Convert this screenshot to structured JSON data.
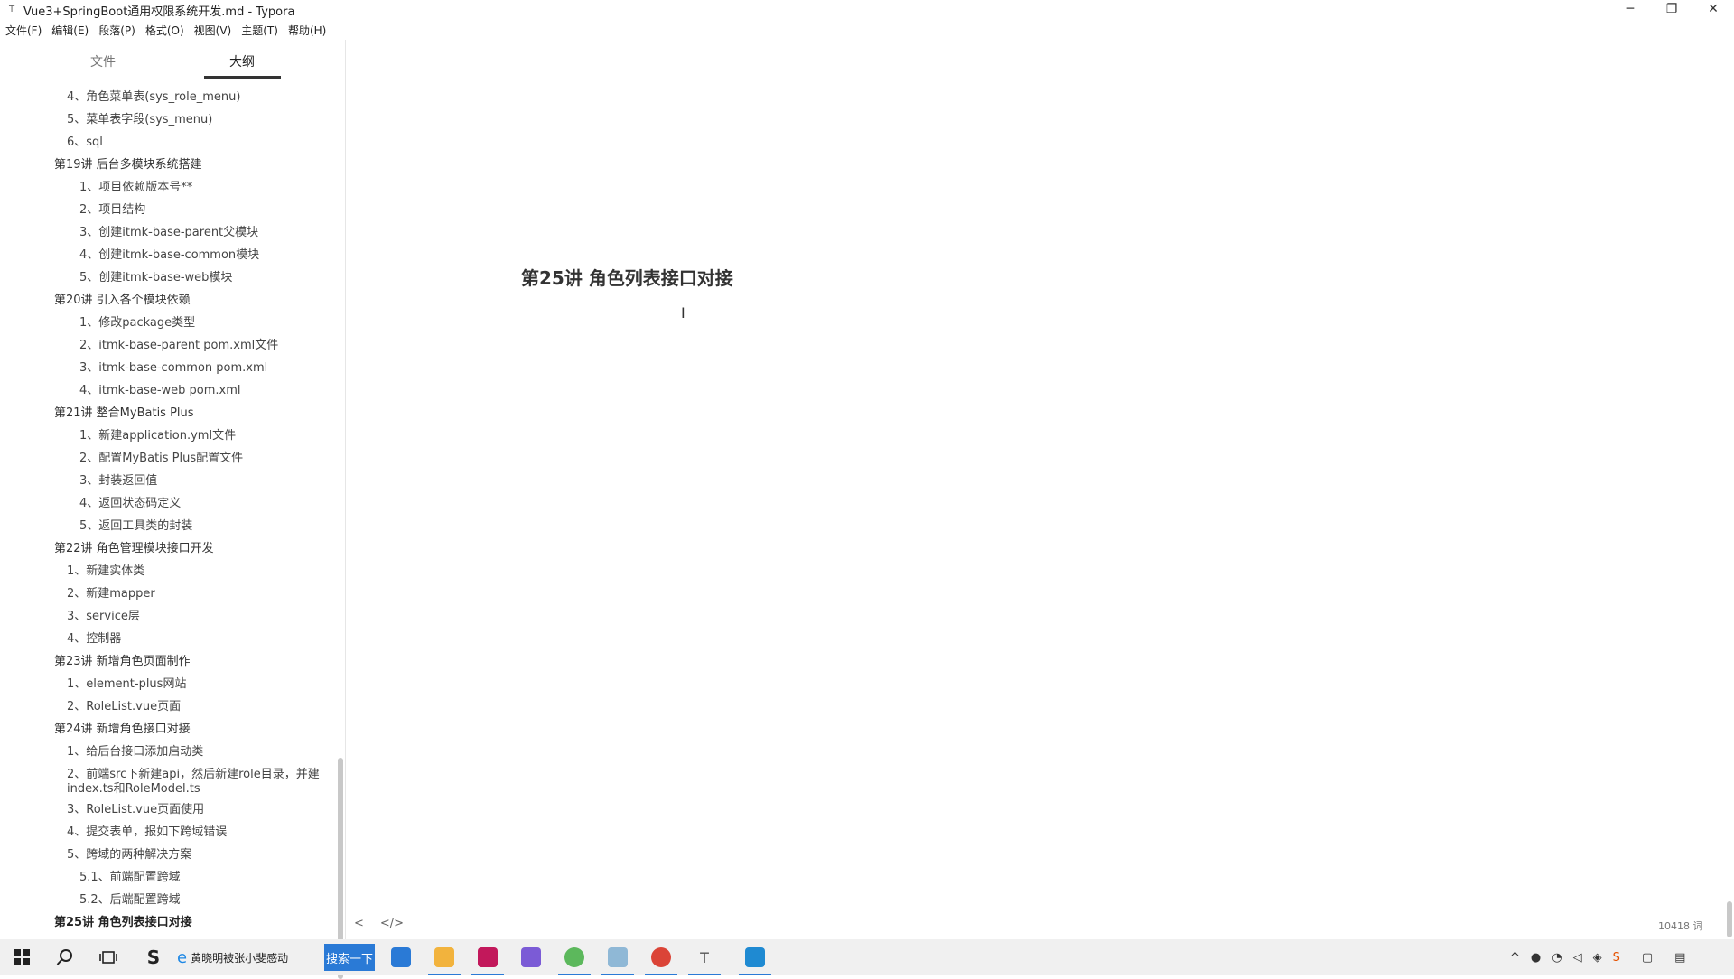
{
  "window": {
    "title": "Vue3+SpringBoot通用权限系统开发.md - Typora",
    "app_icon_text": "T",
    "minimize": "─",
    "maximize": "❐",
    "close": "✕"
  },
  "menu": [
    "文件(F)",
    "编辑(E)",
    "段落(P)",
    "格式(O)",
    "视图(V)",
    "主题(T)",
    "帮助(H)"
  ],
  "sidebar": {
    "tabs": [
      "文件",
      "大纲"
    ],
    "outline": [
      {
        "text": "4、角色菜单表(sys_role_menu)",
        "level": 1
      },
      {
        "text": "5、菜单表字段(sys_menu)",
        "level": 1
      },
      {
        "text": "6、sql",
        "level": 1
      },
      {
        "text": "第19讲 后台多模块系统搭建",
        "level": 0
      },
      {
        "text": "1、项目依赖版本号**",
        "level": 2
      },
      {
        "text": "2、项目结构",
        "level": 2
      },
      {
        "text": "3、创建itmk-base-parent父模块",
        "level": 2
      },
      {
        "text": "4、创建itmk-base-common模块",
        "level": 2
      },
      {
        "text": "5、创建itmk-base-web模块",
        "level": 2
      },
      {
        "text": "第20讲 引入各个模块依赖",
        "level": 0
      },
      {
        "text": "1、修改package类型",
        "level": 2
      },
      {
        "text": "2、itmk-base-parent pom.xml文件",
        "level": 2
      },
      {
        "text": "3、itmk-base-common pom.xml",
        "level": 2
      },
      {
        "text": "4、itmk-base-web pom.xml",
        "level": 2
      },
      {
        "text": "第21讲 整合MyBatis Plus",
        "level": 0
      },
      {
        "text": "1、新建application.yml文件",
        "level": 2
      },
      {
        "text": "2、配置MyBatis Plus配置文件",
        "level": 2
      },
      {
        "text": "3、封装返回值",
        "level": 2
      },
      {
        "text": "4、返回状态码定义",
        "level": 2
      },
      {
        "text": "5、返回工具类的封装",
        "level": 2
      },
      {
        "text": "第22讲 角色管理模块接口开发",
        "level": 0
      },
      {
        "text": "1、新建实体类",
        "level": 1
      },
      {
        "text": "2、新建mapper",
        "level": 1
      },
      {
        "text": "3、service层",
        "level": 1
      },
      {
        "text": "4、控制器",
        "level": 1
      },
      {
        "text": "第23讲 新增角色页面制作",
        "level": 0
      },
      {
        "text": "1、element-plus网站",
        "level": 1
      },
      {
        "text": "2、RoleList.vue页面",
        "level": 1
      },
      {
        "text": "第24讲 新增角色接口对接",
        "level": 0
      },
      {
        "text": "1、给后台接口添加启动类",
        "level": 1
      },
      {
        "text": "2、前端src下新建api，然后新建role目录，并建index.ts和RoleModel.ts",
        "level": 1
      },
      {
        "text": "3、RoleList.vue页面使用",
        "level": 1
      },
      {
        "text": "4、提交表单，报如下跨域错误",
        "level": 1
      },
      {
        "text": "5、跨域的两种解决方案",
        "level": 1
      },
      {
        "text": "5.1、前端配置跨域",
        "level": 2
      },
      {
        "text": "5.2、后端配置跨域",
        "level": 2
      },
      {
        "text": "第25讲 角色列表接口对接",
        "level": 0
      }
    ]
  },
  "editor": {
    "heading": "第25讲 角色列表接口对接",
    "cursor": "I",
    "back_icon": "<",
    "source_icon": "</>",
    "word_count": "10418 词"
  },
  "taskbar": {
    "ie_label": "黄晓明被张小斐感动",
    "search_label": "搜索一下"
  },
  "colors": {
    "accent": "#2a7ad6",
    "taskbar": "#f0f0f0"
  }
}
